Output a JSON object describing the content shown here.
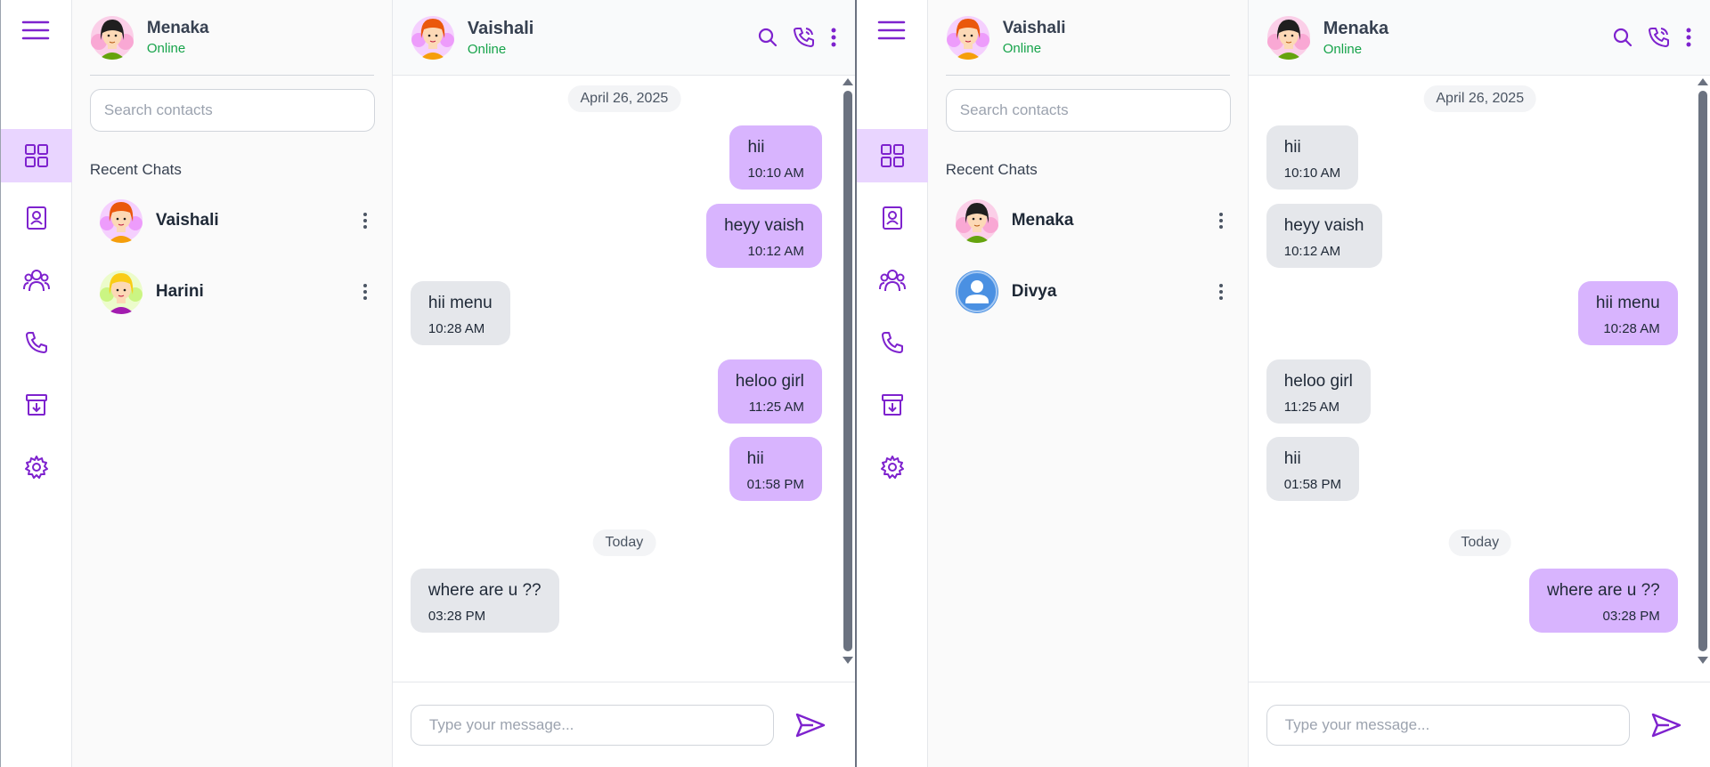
{
  "colors": {
    "accent": "#7e22ce",
    "online": "#16a34a",
    "out_bubble": "#d8b4fe",
    "in_bubble": "#e5e7eb",
    "active_nav": "#e9d5ff"
  },
  "icons": {
    "menu": "hamburger-icon",
    "nav": [
      "dashboard-icon",
      "contacts-icon",
      "groups-icon",
      "phone-icon",
      "archive-icon",
      "settings-icon"
    ],
    "head_actions": [
      "search-icon",
      "call-icon",
      "more-icon"
    ],
    "send": "send-icon"
  },
  "left": {
    "me": {
      "name": "Menaka",
      "status": "Online"
    },
    "search_placeholder": "Search contacts",
    "recent_label": "Recent Chats",
    "chats": [
      {
        "name": "Vaishali"
      },
      {
        "name": "Harini"
      }
    ],
    "conversation": {
      "name": "Vaishali",
      "status": "Online",
      "date1": "April 26, 2025",
      "date2": "Today",
      "messages": [
        {
          "text": "hii",
          "time": "10:10 AM",
          "dir": "out"
        },
        {
          "text": "heyy vaish",
          "time": "10:12 AM",
          "dir": "out"
        },
        {
          "text": "hii menu",
          "time": "10:28 AM",
          "dir": "in"
        },
        {
          "text": "heloo girl",
          "time": "11:25 AM",
          "dir": "out"
        },
        {
          "text": "hii",
          "time": "01:58 PM",
          "dir": "out"
        },
        {
          "text": "where are u ??",
          "time": "03:28 PM",
          "dir": "in"
        }
      ],
      "input_placeholder": "Type your message..."
    }
  },
  "right": {
    "me": {
      "name": "Vaishali",
      "status": "Online"
    },
    "search_placeholder": "Search contacts",
    "recent_label": "Recent Chats",
    "chats": [
      {
        "name": "Menaka"
      },
      {
        "name": "Divya"
      }
    ],
    "conversation": {
      "name": "Menaka",
      "status": "Online",
      "date1": "April 26, 2025",
      "date2": "Today",
      "messages": [
        {
          "text": "hii",
          "time": "10:10 AM",
          "dir": "in"
        },
        {
          "text": "heyy vaish",
          "time": "10:12 AM",
          "dir": "in"
        },
        {
          "text": "hii menu",
          "time": "10:28 AM",
          "dir": "out"
        },
        {
          "text": "heloo girl",
          "time": "11:25 AM",
          "dir": "in"
        },
        {
          "text": "hii",
          "time": "01:58 PM",
          "dir": "in"
        },
        {
          "text": "where are u ??",
          "time": "03:28 PM",
          "dir": "out"
        }
      ],
      "input_placeholder": "Type your message..."
    }
  }
}
